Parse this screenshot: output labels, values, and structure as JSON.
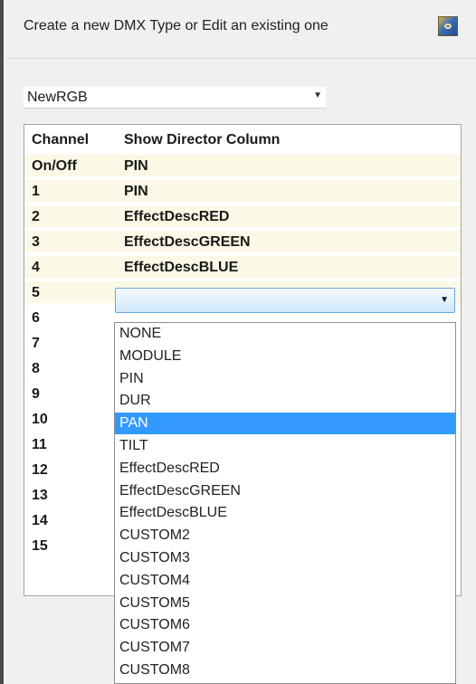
{
  "header": {
    "prompt": "Create a new DMX Type or Edit an existing one"
  },
  "type_select": {
    "value": "NewRGB"
  },
  "grid": {
    "columns": [
      "Channel",
      "Show Director Column"
    ],
    "rows": [
      {
        "channel": "On/Off",
        "director": "PIN"
      },
      {
        "channel": "1",
        "director": "PIN"
      },
      {
        "channel": "2",
        "director": "EffectDescRED"
      },
      {
        "channel": "3",
        "director": "EffectDescGREEN"
      },
      {
        "channel": "4",
        "director": "EffectDescBLUE"
      },
      {
        "channel": "5",
        "director": ""
      },
      {
        "channel": "6",
        "director": ""
      },
      {
        "channel": "7",
        "director": ""
      },
      {
        "channel": "8",
        "director": ""
      },
      {
        "channel": "9",
        "director": ""
      },
      {
        "channel": "10",
        "director": ""
      },
      {
        "channel": "11",
        "director": ""
      },
      {
        "channel": "12",
        "director": ""
      },
      {
        "channel": "13",
        "director": ""
      },
      {
        "channel": "14",
        "director": ""
      },
      {
        "channel": "15",
        "director": ""
      }
    ]
  },
  "dropdown": {
    "selected": "PAN",
    "options": [
      "NONE",
      "MODULE",
      "PIN",
      "DUR",
      "PAN",
      "TILT",
      "EffectDescRED",
      "EffectDescGREEN",
      "EffectDescBLUE",
      "CUSTOM2",
      "CUSTOM3",
      "CUSTOM4",
      "CUSTOM5",
      "CUSTOM6",
      "CUSTOM7",
      "CUSTOM8"
    ]
  }
}
